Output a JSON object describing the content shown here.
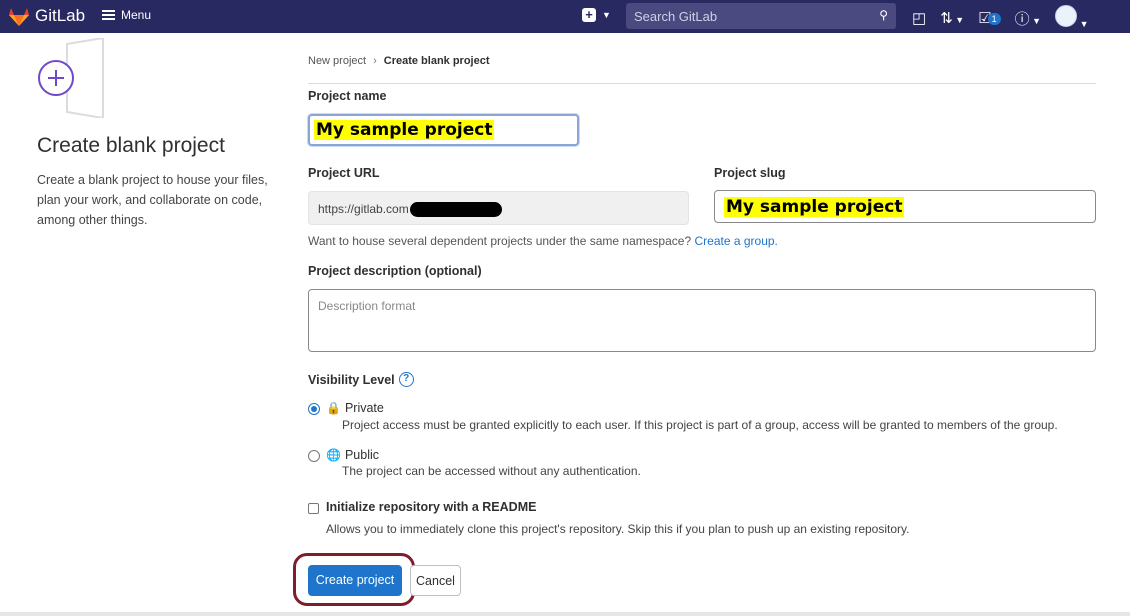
{
  "topbar": {
    "brand": "GitLab",
    "menu_label": "Menu",
    "search_placeholder": "Search GitLab",
    "todos_count": "1",
    "colors": {
      "bar": "#292961",
      "accent": "#1f75cb"
    }
  },
  "sidebar": {
    "title": "Create blank project",
    "description": "Create a blank project to house your files, plan your work, and collaborate on code, among other things."
  },
  "breadcrumb": {
    "parent": "New project",
    "current": "Create blank project"
  },
  "form": {
    "project_name_label": "Project name",
    "project_name_value": "My sample project",
    "project_url_label": "Project URL",
    "project_url_value": "https://gitlab.com",
    "project_slug_label": "Project slug",
    "project_slug_value": "My sample project",
    "namespace_hint": "Want to house several dependent projects under the same namespace?",
    "create_group_link": "Create a group.",
    "description_label": "Project description (optional)",
    "description_placeholder": "Description format",
    "visibility_label": "Visibility Level",
    "visibility_options": [
      {
        "title": "Private",
        "icon": "lock-icon",
        "selected": true,
        "description": "Project access must be granted explicitly to each user. If this project is part of a group, access will be granted to members of the group."
      },
      {
        "title": "Public",
        "icon": "globe-icon",
        "selected": false,
        "description": "The project can be accessed without any authentication."
      }
    ],
    "readme_label": "Initialize repository with a README",
    "readme_description": "Allows you to immediately clone this project's repository. Skip this if you plan to push up an existing repository.",
    "readme_checked": false,
    "create_button": "Create project",
    "cancel_button": "Cancel"
  }
}
